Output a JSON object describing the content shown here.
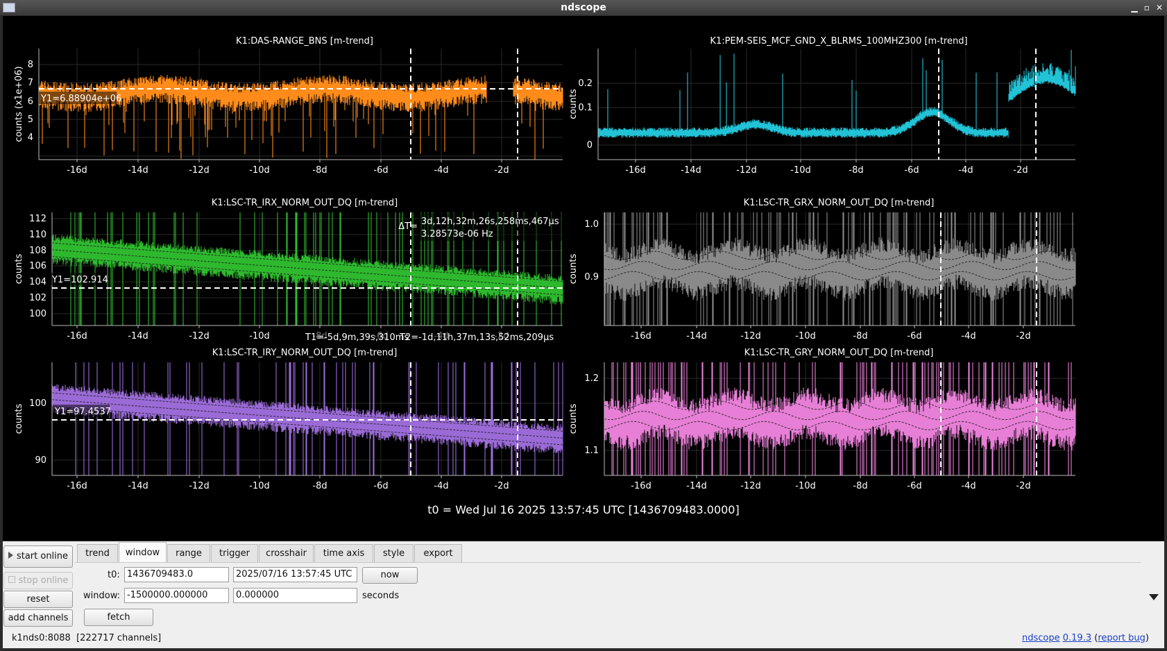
{
  "window": {
    "title": "ndscope"
  },
  "t0_label": "t0 = Wed Jul 16 2025 13:57:45 UTC [1436709483.0000]",
  "colors": {
    "orange": "#ff8c1a",
    "cyan": "#22c3d6",
    "green": "#2eb82e",
    "gray": "#8a8a8a",
    "purple": "#9a6bd6",
    "pink": "#e77fd6"
  },
  "plots": [
    {
      "id": "das-range",
      "title": "K1:DAS-RANGE_BNS [m-trend]",
      "ylabel": "counts (x1e+06)",
      "yticks": [
        "8",
        "7",
        "6",
        "5",
        "4"
      ],
      "xticks": [
        "-16d",
        "-14d",
        "-12d",
        "-10d",
        "-8d",
        "-6d",
        "-4d",
        "-2d"
      ],
      "cursor_label": "Y1=6.88904e+06"
    },
    {
      "id": "pem-seis",
      "title": "K1:PEM-SEIS_MCF_GND_X_BLRMS_100MHZ300 [m-trend]",
      "ylabel": "counts",
      "yticks": [
        "0.2",
        "0.1",
        "0"
      ],
      "xticks": [
        "-16d",
        "-14d",
        "-12d",
        "-10d",
        "-8d",
        "-6d",
        "-4d",
        "-2d"
      ]
    },
    {
      "id": "tr-irx",
      "title": "K1:LSC-TR_IRX_NORM_OUT_DQ [m-trend]",
      "ylabel": "counts",
      "yticks": [
        "112",
        "110",
        "108",
        "106",
        "104",
        "102",
        "100"
      ],
      "xticks": [
        "-16d",
        "-14d",
        "-12d",
        "-10d",
        "-8d",
        "-6d",
        "-4d",
        "-2d"
      ],
      "cursor_label": "Y1=102.914",
      "delta_t_label": "ΔT=",
      "delta_t": "3d,12h,32m,26s,258ms,467µs",
      "delta_f": "3.28573e-06 Hz",
      "t1_label": "T1=-5d,9m,39s,310ms",
      "t2_label": "T2=-1d,11h,37m,13s,52ms,209µs"
    },
    {
      "id": "tr-grx",
      "title": "K1:LSC-TR_GRX_NORM_OUT_DQ [m-trend]",
      "ylabel": "counts",
      "yticks": [
        "1.0",
        "0.9"
      ],
      "xticks": [
        "-16d",
        "-14d",
        "-12d",
        "-10d",
        "-8d",
        "-6d",
        "-4d",
        "-2d"
      ]
    },
    {
      "id": "tr-iry",
      "title": "K1:LSC-TR_IRY_NORM_OUT_DQ [m-trend]",
      "ylabel": "counts",
      "yticks": [
        "100",
        "90"
      ],
      "xticks": [
        "-16d",
        "-14d",
        "-12d",
        "-10d",
        "-8d",
        "-6d",
        "-4d",
        "-2d"
      ],
      "cursor_label": "Y1=97.4537"
    },
    {
      "id": "tr-gry",
      "title": "K1:LSC-TR_GRY_NORM_OUT_DQ [m-trend]",
      "ylabel": "counts",
      "yticks": [
        "1.2",
        "1.1"
      ],
      "xticks": [
        "-16d",
        "-14d",
        "-12d",
        "-10d",
        "-8d",
        "-6d",
        "-4d",
        "-2d"
      ]
    }
  ],
  "controls": {
    "start_online": "start online",
    "stop_online": "stop online",
    "reset": "reset",
    "add_channels": "add channels",
    "tabs": [
      "trend",
      "window",
      "range",
      "trigger",
      "crosshair",
      "time axis",
      "style",
      "export"
    ],
    "active_tab": "window",
    "t0_label": "t0:",
    "t0_gps": "1436709483.0",
    "t0_utc": "2025/07/16 13:57:45 UTC",
    "now": "now",
    "window_label": "window:",
    "window_start": "-1500000.000000",
    "window_end": "0.000000",
    "seconds": "seconds",
    "fetch": "fetch"
  },
  "status": {
    "server": "k1nds0:8088",
    "channels": "[222717 channels]",
    "app": "ndscope",
    "version": "0.19.3",
    "report_bug": "report bug"
  }
}
